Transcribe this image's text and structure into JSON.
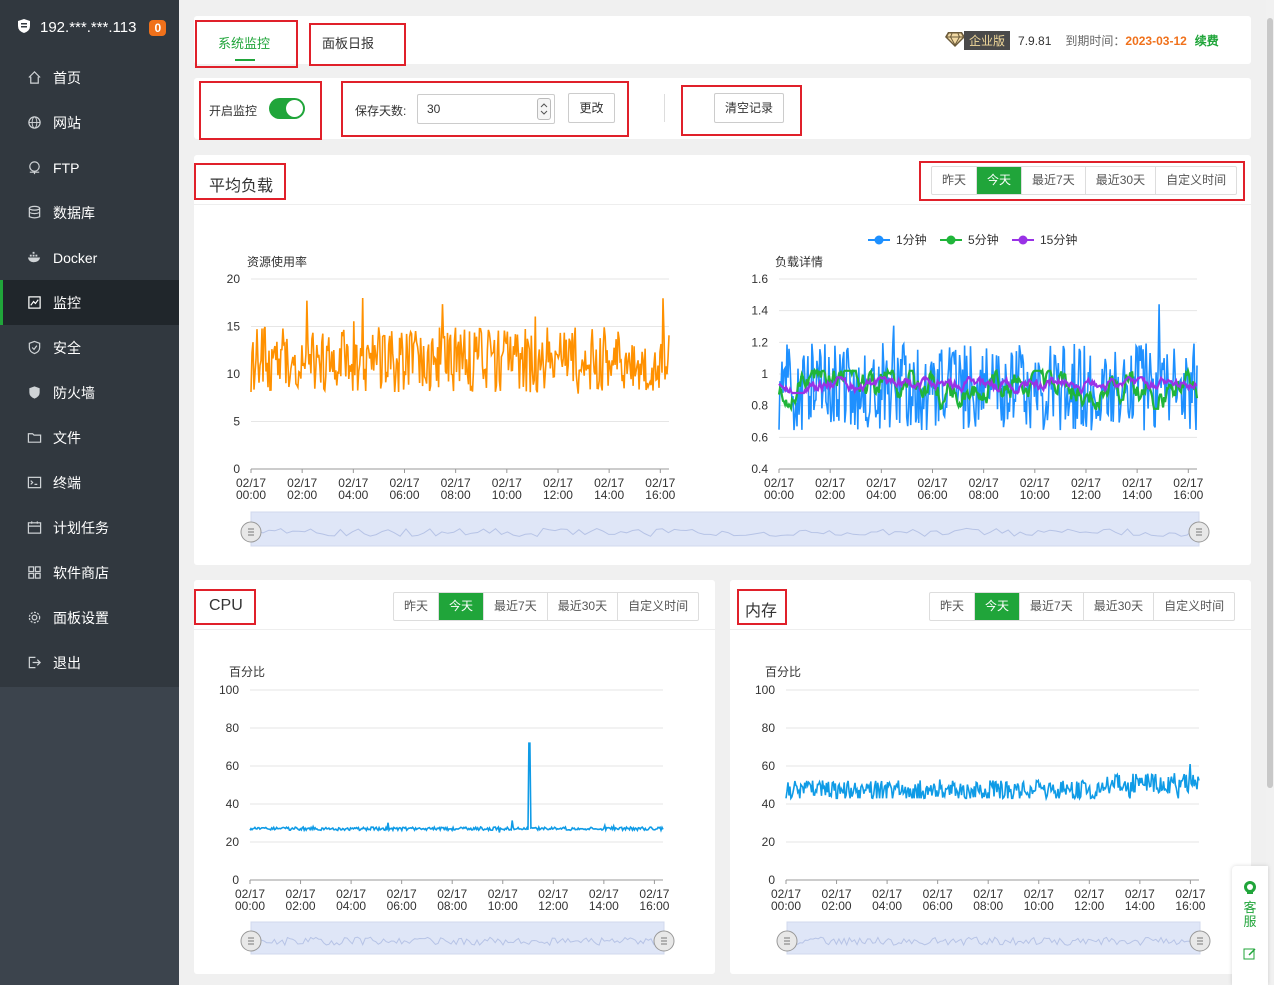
{
  "sidebar": {
    "host": "192.***.***.113",
    "badge": "0",
    "items": [
      {
        "label": "首页",
        "icon": "home-icon"
      },
      {
        "label": "网站",
        "icon": "globe-icon"
      },
      {
        "label": "FTP",
        "icon": "ftp-icon"
      },
      {
        "label": "数据库",
        "icon": "database-icon"
      },
      {
        "label": "Docker",
        "icon": "docker-icon"
      },
      {
        "label": "监控",
        "icon": "monitor-icon"
      },
      {
        "label": "安全",
        "icon": "shield-icon"
      },
      {
        "label": "防火墙",
        "icon": "firewall-icon"
      },
      {
        "label": "文件",
        "icon": "folder-icon"
      },
      {
        "label": "终端",
        "icon": "terminal-icon"
      },
      {
        "label": "计划任务",
        "icon": "calendar-icon"
      },
      {
        "label": "软件商店",
        "icon": "apps-icon"
      },
      {
        "label": "面板设置",
        "icon": "gear-icon"
      },
      {
        "label": "退出",
        "icon": "logout-icon"
      }
    ],
    "active_index": 5
  },
  "header": {
    "tab_monitor": "系统监控",
    "tab_daily": "面板日报",
    "edition": "企业版",
    "version": "7.9.81",
    "expire_label": "到期时间：",
    "expire_date": "2023-03-12",
    "renew": "续费"
  },
  "controls": {
    "enable_label": "开启监控",
    "enable_on": true,
    "days_label": "保存天数:",
    "days_value": "30",
    "change_button": "更改",
    "clear_button": "清空记录"
  },
  "ranges": [
    "昨天",
    "今天",
    "最近7天",
    "最近30天",
    "自定义时间"
  ],
  "active_range": "今天",
  "sections": {
    "load": "平均负载",
    "cpu": "CPU",
    "mem": "内存"
  },
  "colors": {
    "accent": "#20a53a",
    "orange": "#ff9100",
    "blue": "#1e90ff",
    "green": "#20b53a",
    "purple": "#9932e6",
    "cpu_line": "#0f9be6"
  },
  "chart_data": [
    {
      "type": "line",
      "title": "资源使用率",
      "x_labels": [
        "02/17 00:00",
        "02/17 02:00",
        "02/17 04:00",
        "02/17 06:00",
        "02/17 08:00",
        "02/17 10:00",
        "02/17 12:00",
        "02/17 14:00",
        "02/17 16:00"
      ],
      "x_range": [
        "02/17 00:00",
        "02/17 16:10"
      ],
      "ylim": [
        0,
        20
      ],
      "yticks": [
        0,
        5,
        10,
        15,
        20
      ],
      "series": [
        {
          "color": "#ff9100",
          "mean": 11.5,
          "range": [
            6.5,
            18
          ]
        }
      ]
    },
    {
      "type": "line",
      "title": "负载详情",
      "x_labels": [
        "02/17 00:00",
        "02/17 02:00",
        "02/17 04:00",
        "02/17 06:00",
        "02/17 08:00",
        "02/17 10:00",
        "02/17 12:00",
        "02/17 14:00",
        "02/17 16:00"
      ],
      "x_range": [
        "02/17 00:00",
        "02/17 16:10"
      ],
      "ylim": [
        0.4,
        1.6
      ],
      "yticks": [
        0.4,
        0.6,
        0.8,
        1,
        1.2,
        1.4,
        1.6
      ],
      "legend": "top",
      "series": [
        {
          "name": "1分钟",
          "color": "#1e90ff",
          "mean": 0.92,
          "range": [
            0.52,
            1.44
          ]
        },
        {
          "name": "5分钟",
          "color": "#20b53a",
          "mean": 0.92,
          "range": [
            0.78,
            1.02
          ]
        },
        {
          "name": "15分钟",
          "color": "#9932e6",
          "mean": 0.93,
          "range": [
            0.88,
            0.98
          ]
        }
      ]
    },
    {
      "type": "line",
      "title": "百分比",
      "x_labels": [
        "02/17 00:00",
        "02/17 02:00",
        "02/17 04:00",
        "02/17 06:00",
        "02/17 08:00",
        "02/17 10:00",
        "02/17 12:00",
        "02/17 14:00",
        "02/17 16:00"
      ],
      "x_range": [
        "02/17 00:00",
        "02/17 16:10"
      ],
      "ylim": [
        0,
        100
      ],
      "yticks": [
        0,
        20,
        40,
        60,
        80,
        100
      ],
      "series": [
        {
          "color": "#0f9be6",
          "mean": 27,
          "range": [
            25,
            32
          ],
          "spike": {
            "x": "02/17 11:00",
            "y": 72
          }
        }
      ]
    },
    {
      "type": "line",
      "title": "百分比",
      "x_labels": [
        "02/17 00:00",
        "02/17 02:00",
        "02/17 04:00",
        "02/17 06:00",
        "02/17 08:00",
        "02/17 10:00",
        "02/17 12:00",
        "02/17 14:00",
        "02/17 16:00"
      ],
      "x_range": [
        "02/17 00:00",
        "02/17 16:10"
      ],
      "ylim": [
        0,
        100
      ],
      "yticks": [
        0,
        20,
        40,
        60,
        80,
        100
      ],
      "series": [
        {
          "color": "#0f9be6",
          "levels": [
            {
              "from": "02/17 00:00",
              "to": "02/17 12:30",
              "mean": 47
            },
            {
              "from": "02/17 12:30",
              "to": "02/17 16:10",
              "mean": 51
            }
          ],
          "range": [
            43,
            61
          ]
        }
      ]
    }
  ],
  "floating": {
    "service": "客服"
  }
}
